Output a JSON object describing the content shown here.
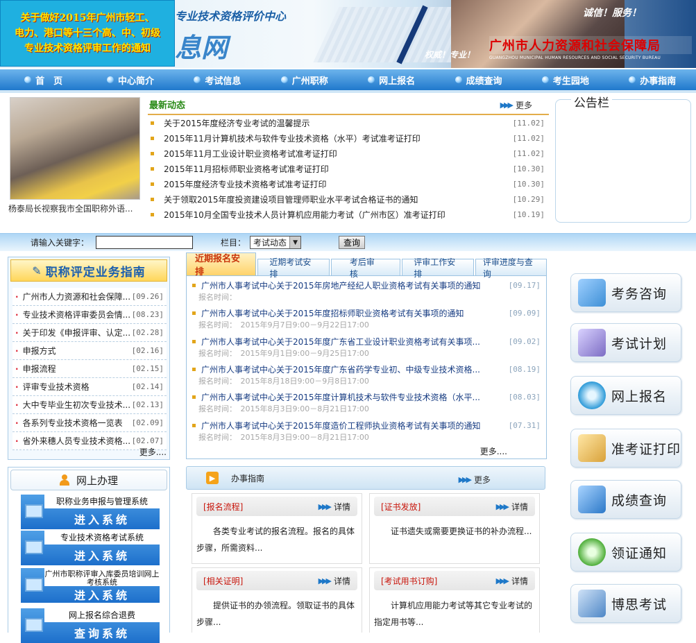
{
  "banner": {
    "notice": "关于做好2015年广州市轻工、\n电力、港口等十三个高、中、初级\n专业技术资格评审工作的通知",
    "site_subtitle": "专业技术资格评价中心",
    "site_name_fragment": "息网",
    "slogan_right": "诚信！服务！",
    "slogan_left": "权威！专业！",
    "bureau_name": "广州市人力资源和社会保障局",
    "bureau_en": "GUANGZHOU MUNICIPAL HUMAN RESOURCES AND SOCIAL SECURITY BUREAU"
  },
  "nav": [
    "首　页",
    "中心简介",
    "考试信息",
    "广州职称",
    "网上报名",
    "成绩查询",
    "考生园地",
    "办事指南"
  ],
  "news_photo": {
    "caption": "杨泰局长视察我市全国职称外语..."
  },
  "latest": {
    "title": "最新动态",
    "more": "更多",
    "items": [
      {
        "text": "关于2015年度经济专业考试的温馨提示",
        "date": "[11.02]"
      },
      {
        "text": "2015年11月计算机技术与软件专业技术资格（水平）考试准考证打印",
        "date": "[11.02]"
      },
      {
        "text": "2015年11月工业设计职业资格考试准考证打印",
        "date": "[11.02]"
      },
      {
        "text": "2015年11月招标师职业资格考试准考证打印",
        "date": "[10.30]"
      },
      {
        "text": "2015年度经济专业技术资格考试准考证打印",
        "date": "[10.30]"
      },
      {
        "text": "关于领取2015年度投资建设项目管理师职业水平考试合格证书的通知",
        "date": "[10.29]"
      },
      {
        "text": "2015年10月全国专业技术人员计算机应用能力考试（广州市区）准考证打印",
        "date": "[10.19]"
      }
    ]
  },
  "board": {
    "title": "公告栏"
  },
  "search": {
    "keyword_label": "请输入关键字：",
    "keyword_value": "",
    "column_label": "栏目：",
    "column_value": "考试动态",
    "button": "查询"
  },
  "guide": {
    "title": "职称评定业务指南",
    "more": "更多....",
    "items": [
      {
        "text": "广州市人力资源和社会保障...",
        "date": "[09.26]"
      },
      {
        "text": "专业技术资格评审委员会情...",
        "date": "[08.23]"
      },
      {
        "text": "关于印发《申报评审、认定...",
        "date": "[02.28]"
      },
      {
        "text": "申报方式",
        "date": "[02.16]"
      },
      {
        "text": "申报流程",
        "date": "[02.15]"
      },
      {
        "text": "评审专业技术资格",
        "date": "[02.14]"
      },
      {
        "text": "大中专毕业生初次专业技术...",
        "date": "[02.13]"
      },
      {
        "text": "各系列专业技术资格一览表",
        "date": "[02.09]"
      },
      {
        "text": "省外来穗人员专业技术资格...",
        "date": "[02.07]"
      }
    ]
  },
  "online": {
    "title": "网上办理",
    "systems": [
      {
        "name": "职称业务申报与管理系统",
        "enter": "进入系统"
      },
      {
        "name": "专业技术资格考试系统",
        "enter": "进入系统"
      },
      {
        "name": "广州市职称评审入库委员培训网上考核系统",
        "enter": "进入系统"
      },
      {
        "name": "网上报名综合退费",
        "enter": "查询系统"
      }
    ]
  },
  "tabs": [
    "近期报名安排",
    "近期考试安排",
    "考后审核",
    "评审工作安排",
    "评审进度与查询"
  ],
  "exams": {
    "more": "更多....",
    "items": [
      {
        "title": "广州市人事考试中心关于2015年房地产经纪人职业资格考试有关事项的通知",
        "date": "[09.17]",
        "time": "报名时间："
      },
      {
        "title": "广州市人事考试中心关于2015年度招标师职业资格考试有关事项的通知",
        "date": "[09.09]",
        "time": "报名时间：　2015年9月7日9:00－9月22日17:00"
      },
      {
        "title": "广州市人事考试中心关于2015年度广东省工业设计职业资格考试有关事项...",
        "date": "[09.02]",
        "time": "报名时间：　2015年9月1日9:00－9月25日17:00"
      },
      {
        "title": "广州市人事考试中心关于2015年度广东省药学专业初、中级专业技术资格...",
        "date": "[08.19]",
        "time": "报名时间：　2015年8月18日9:00－9月8日17:00"
      },
      {
        "title": "广州市人事考试中心关于2015年度计算机技术与软件专业技术资格（水平...",
        "date": "[08.03]",
        "time": "报名时间：　2015年8月3日9:00－8月21日17:00"
      },
      {
        "title": "广州市人事考试中心关于2015年度造价工程师执业资格考试有关事项的通知",
        "date": "[07.31]",
        "time": "报名时间：　2015年8月3日9:00－8月21日17:00"
      }
    ]
  },
  "service_guide": {
    "title": "办事指南",
    "more": "更多",
    "cards": [
      {
        "tag": "[报名流程]",
        "detail": "详情",
        "body": "各类专业考试的报名流程。报名的具体步骤，所需资料..."
      },
      {
        "tag": "[证书发放]",
        "detail": "详情",
        "body": "证书遗失或需要更换证书的补办流程..."
      },
      {
        "tag": "[相关证明]",
        "detail": "详情",
        "body": "提供证书的办领流程。领取证书的具体步骤..."
      },
      {
        "tag": "[考试用书订购]",
        "detail": "详情",
        "body": "计算机应用能力考试等其它专业考试的指定用书等..."
      }
    ]
  },
  "side_buttons": [
    {
      "label": "考务咨询",
      "icon": "consult-icon",
      "color": "#3d8fd6"
    },
    {
      "label": "考试计划",
      "icon": "plan-icon",
      "color": "#7c6cc4"
    },
    {
      "label": "网上报名",
      "icon": "register-icon",
      "color": "#2d9ad8"
    },
    {
      "label": "准考证打印",
      "icon": "print-icon",
      "color": "#d9a23a"
    },
    {
      "label": "成绩查询",
      "icon": "score-icon",
      "color": "#2b78c8"
    },
    {
      "label": "领证通知",
      "icon": "certificate-icon",
      "color": "#4fae3a"
    },
    {
      "label": "博思考试",
      "icon": "exam-icon",
      "color": "#4d86c6"
    }
  ]
}
